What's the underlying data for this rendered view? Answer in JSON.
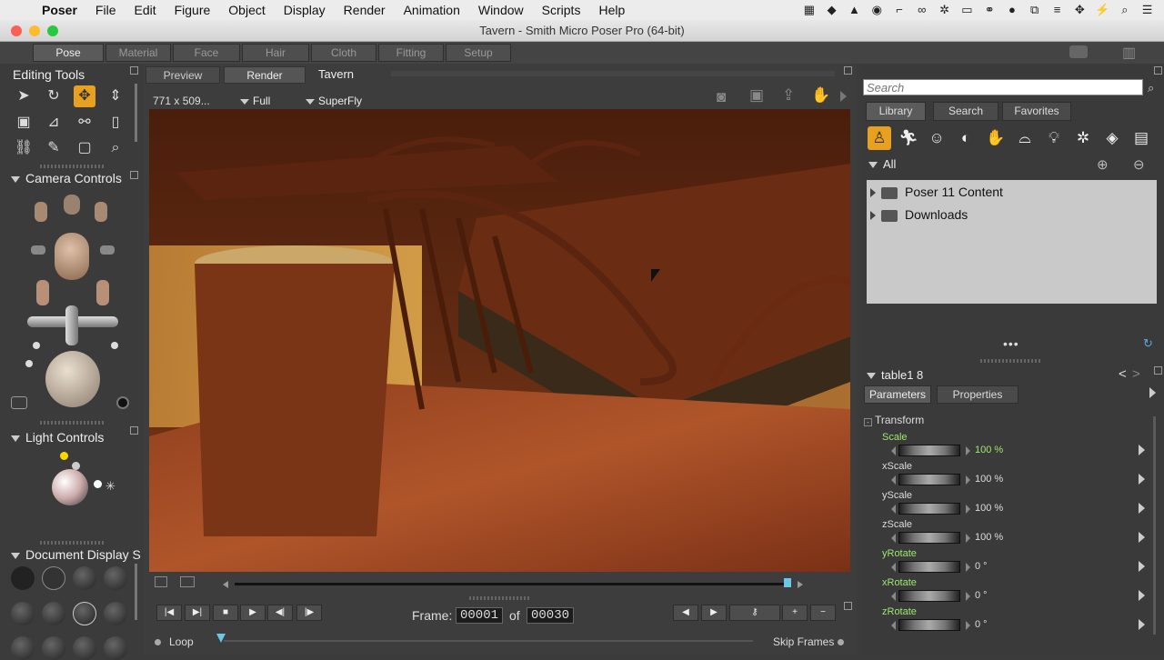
{
  "menubar": {
    "apple": "",
    "app": "Poser",
    "items": [
      "File",
      "Edit",
      "Figure",
      "Object",
      "Display",
      "Render",
      "Animation",
      "Window",
      "Scripts",
      "Help"
    ]
  },
  "window": {
    "title": "Tavern - Smith Micro Poser Pro  (64-bit)"
  },
  "rooms": [
    "Pose",
    "Material",
    "Face",
    "Hair",
    "Cloth",
    "Fitting",
    "Setup"
  ],
  "editing_tools": {
    "title": "Editing Tools"
  },
  "camera_controls": {
    "title": "Camera Controls"
  },
  "light_controls": {
    "title": "Light Controls"
  },
  "document_display": {
    "title": "Document Display S"
  },
  "document": {
    "tabs": [
      "Preview",
      "Render"
    ],
    "name": "Tavern",
    "size": "771 x 509...",
    "resolution": "Full",
    "renderer": "SuperFly"
  },
  "playback": {
    "frame_label": "Frame:",
    "current_frame": "00001",
    "of_label": "of",
    "total_frames": "00030",
    "loop_label": "Loop",
    "skip_frames_label": "Skip Frames"
  },
  "library": {
    "search_placeholder": "Search",
    "tabs": [
      "Library",
      "Search",
      "Favorites"
    ],
    "filter": "All",
    "folders": [
      "Poser 11 Content",
      "Downloads"
    ]
  },
  "properties": {
    "object_name": "table1 8",
    "tabs": [
      "Parameters",
      "Properties"
    ],
    "group": "Transform",
    "params": [
      {
        "name": "Scale",
        "value": "100 %",
        "highlight": true
      },
      {
        "name": "xScale",
        "value": "100 %",
        "highlight": false
      },
      {
        "name": "yScale",
        "value": "100 %",
        "highlight": false
      },
      {
        "name": "zScale",
        "value": "100 %",
        "highlight": false
      },
      {
        "name": "yRotate",
        "value": "0 °",
        "highlight": true
      },
      {
        "name": "xRotate",
        "value": "0 °",
        "highlight": true
      },
      {
        "name": "zRotate",
        "value": "0 °",
        "highlight": true
      }
    ]
  },
  "colors": {
    "accent_orange": "#e8a020",
    "highlight_green": "#9fe870",
    "panel_bg": "#3b3b3b"
  }
}
